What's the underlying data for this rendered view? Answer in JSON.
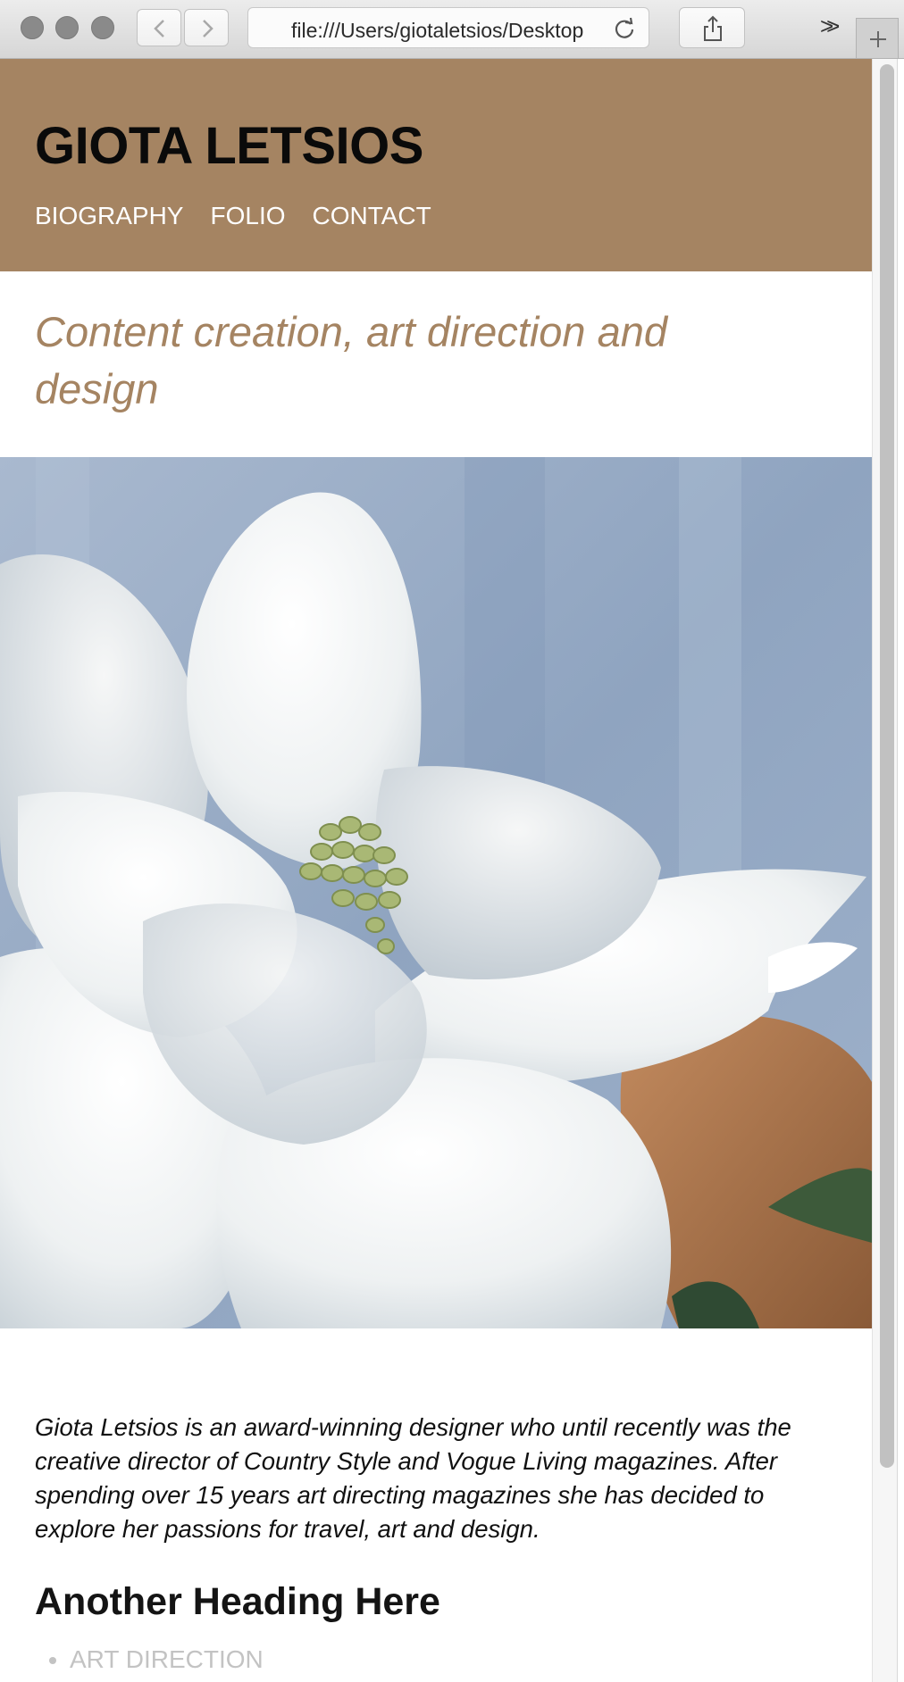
{
  "browser": {
    "url": "file:///Users/giotaletsios/Desktop",
    "overflow_label": ">>"
  },
  "site": {
    "title": "GIOTA LETSIOS",
    "nav": [
      "BIOGRAPHY",
      "FOLIO",
      "CONTACT"
    ],
    "tagline": "Content creation, art direction and design",
    "bio": "Giota Letsios is an award-winning designer who until recently was the creative director of Country Style and Vogue Living magazines. After spending over 15 years art directing magazines she has decided to explore her passions for travel, art and design.",
    "section_heading": "Another Heading Here",
    "services": [
      "ART DIRECTION"
    ]
  },
  "colors": {
    "header_bg": "#a58462",
    "tagline": "#a58462",
    "nav_text": "#ffffff",
    "list_text": "#c3c3c3"
  },
  "icons": {
    "back": "chevron-left-icon",
    "forward": "chevron-right-icon",
    "reload": "reload-icon",
    "share": "share-icon",
    "new_tab": "plus-icon"
  },
  "hero_image": "white-magnolia-flower"
}
